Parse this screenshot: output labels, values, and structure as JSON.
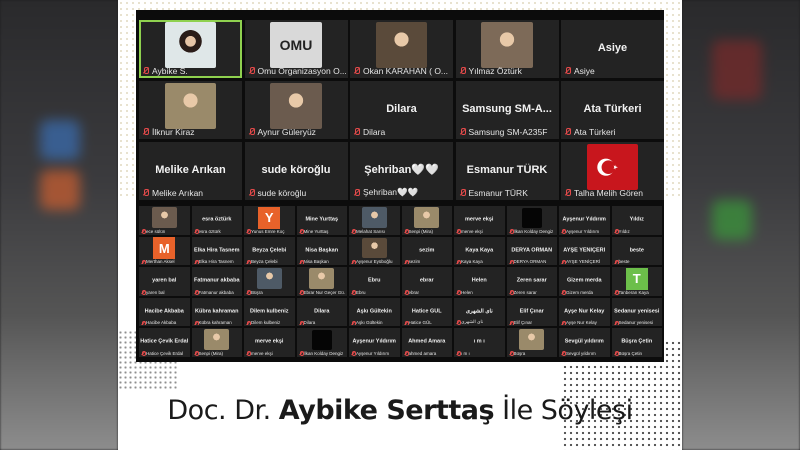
{
  "large_tiles": [
    {
      "label": "Aybike S.",
      "big": "",
      "type": "video",
      "active": true
    },
    {
      "label": "Omu Organizasyon O...",
      "big": "",
      "type": "logo",
      "logo_text": "OMU"
    },
    {
      "label": "Okan KARAHAN ( O...",
      "big": "",
      "type": "video"
    },
    {
      "label": "Yılmaz Öztürk",
      "big": "",
      "type": "video"
    },
    {
      "label": "Asiye",
      "big": "Asiye",
      "type": "name"
    },
    {
      "label": "İlknur Kiraz",
      "big": "",
      "type": "video"
    },
    {
      "label": "Aynur Güleryüz",
      "big": "",
      "type": "video"
    },
    {
      "label": "Dilara",
      "big": "Dilara",
      "type": "name"
    },
    {
      "label": "Samsung SM-A235F",
      "big": "Samsung SM-A...",
      "type": "name"
    },
    {
      "label": "Ata Türkeri",
      "big": "Ata Türkeri",
      "type": "name"
    },
    {
      "label": "Melike Arıkan",
      "big": "Melike Arıkan",
      "type": "name"
    },
    {
      "label": "sude köroğlu",
      "big": "sude köroğlu",
      "type": "name"
    },
    {
      "label": "Şehriban🤍🤍",
      "big": "Şehriban🤍🤍",
      "type": "name"
    },
    {
      "label": "Esmanur TÜRK",
      "big": "Esmanur TÜRK",
      "type": "name"
    },
    {
      "label": "Talha Melih Gören",
      "big": "",
      "type": "flag"
    }
  ],
  "small_tiles": [
    {
      "label": "ece sülün",
      "big": "",
      "type": "video"
    },
    {
      "label": "esra öztürk",
      "big": "esra öztürk",
      "type": "name"
    },
    {
      "label": "Yunus Emre Koç",
      "big": "",
      "type": "letter",
      "letter": "Y",
      "color": "#e8622a"
    },
    {
      "label": "Mine Yurttaş",
      "big": "Mine Yurttaş",
      "type": "name"
    },
    {
      "label": "Melahat Sarısı",
      "big": "",
      "type": "video"
    },
    {
      "label": "Senpi (Mira)",
      "big": "",
      "type": "video"
    },
    {
      "label": "merve ekşi",
      "big": "merve ekşi",
      "type": "name"
    },
    {
      "label": "İlkan Kolday Dengiz",
      "big": "",
      "type": "dark"
    },
    {
      "label": "Ayşenur Yıldırım",
      "big": "Ayşenur Yıldırım",
      "type": "name"
    },
    {
      "label": "Yıldız",
      "big": "Yıldız",
      "type": "name"
    },
    {
      "label": "Merthan Aksel",
      "big": "",
      "type": "letter",
      "letter": "M",
      "color": "#e8622a"
    },
    {
      "label": "Elka Hira Tasnem",
      "big": "Elka Hira Tasnem",
      "type": "name"
    },
    {
      "label": "Beyza Çelebi",
      "big": "Beyza Çelebi",
      "type": "name"
    },
    {
      "label": "Nisa Başkan",
      "big": "Nisa Başkan",
      "type": "name"
    },
    {
      "label": "Ayşenur Eyüboğlu",
      "big": "",
      "type": "video"
    },
    {
      "label": "sezim",
      "big": "sezim",
      "type": "name"
    },
    {
      "label": "Kaya Kaya",
      "big": "Kaya Kaya",
      "type": "name"
    },
    {
      "label": "DERYA ORMAN",
      "big": "DERYA ORMAN",
      "type": "name"
    },
    {
      "label": "AYŞE YENİÇERİ",
      "big": "AYŞE YENİÇERİ",
      "type": "name"
    },
    {
      "label": "beste",
      "big": "beste",
      "type": "name"
    },
    {
      "label": "yaren bal",
      "big": "yaren bal",
      "type": "name"
    },
    {
      "label": "Fatmanur akbaba",
      "big": "Fatmanur akbaba",
      "type": "name"
    },
    {
      "label": "Büşra",
      "big": "",
      "type": "video"
    },
    {
      "label": "Ebrar Nur Geçer Gü...",
      "big": "",
      "type": "video"
    },
    {
      "label": "Ebru",
      "big": "Ebru",
      "type": "name"
    },
    {
      "label": "ebrar",
      "big": "ebrar",
      "type": "name"
    },
    {
      "label": "Helen",
      "big": "Helen",
      "type": "name"
    },
    {
      "label": "Zeren sarar",
      "big": "Zeren sarar",
      "type": "name"
    },
    {
      "label": "Gizem merda",
      "big": "Gizem merda",
      "type": "name"
    },
    {
      "label": "Tanberan Kaya",
      "big": "",
      "type": "letter",
      "letter": "T",
      "color": "#6cbf4a"
    },
    {
      "label": "Hacibe Akbaba",
      "big": "Hacibe Akbaba",
      "type": "name"
    },
    {
      "label": "Kübra kahraman",
      "big": "Kübra kahraman",
      "type": "name"
    },
    {
      "label": "Dilem kulbeniz",
      "big": "Dilem kulbeniz",
      "type": "name"
    },
    {
      "label": "Dilara",
      "big": "Dilara",
      "type": "name"
    },
    {
      "label": "Aşkı Gültekin",
      "big": "Aşkı Gültekin",
      "type": "name"
    },
    {
      "label": "Hatice GÜL",
      "big": "Hatice GÜL",
      "type": "name"
    },
    {
      "label": "نای الشهری",
      "big": "نای الشهری",
      "type": "name"
    },
    {
      "label": "Elif Çınar",
      "big": "Elif Çınar",
      "type": "name"
    },
    {
      "label": "Ayşe Nur Kelay",
      "big": "Ayşe Nur Kelay",
      "type": "name"
    },
    {
      "label": "Sedanur yenisesi",
      "big": "Sedanur yenisesi",
      "type": "name"
    },
    {
      "label": "Hatice Çevik Erdal",
      "big": "Hatice Çevik Erdal",
      "type": "name"
    },
    {
      "label": "Senpi (Mira)",
      "big": "",
      "type": "video"
    },
    {
      "label": "merve ekşi",
      "big": "merve ekşi",
      "type": "name"
    },
    {
      "label": "İlkan Kolday Dengiz",
      "big": "",
      "type": "dark"
    },
    {
      "label": "Ayşenur Yıldırım",
      "big": "Ayşenur Yıldırım",
      "type": "name"
    },
    {
      "label": "ahmed amara",
      "big": "Ahmed Amara",
      "type": "name"
    },
    {
      "label": "ı m ı",
      "big": "ı m ı",
      "type": "name"
    },
    {
      "label": "Büşra",
      "big": "",
      "type": "video"
    },
    {
      "label": "Sevgül yıldırım",
      "big": "Sevgül yıldırım",
      "type": "name"
    },
    {
      "label": "Büşra Çetin",
      "big": "Büşra Çetin",
      "type": "name"
    }
  ],
  "title": {
    "prefix": "Doc. Dr. ",
    "name": "Aybike Serttaş",
    "suffix": " İle Söyleşi"
  },
  "colors": {
    "zoom_bg": "#0c0c0c",
    "tile_bg": "#232323",
    "active_border": "#8fd14f",
    "muted_mic": "#e34a4a"
  }
}
